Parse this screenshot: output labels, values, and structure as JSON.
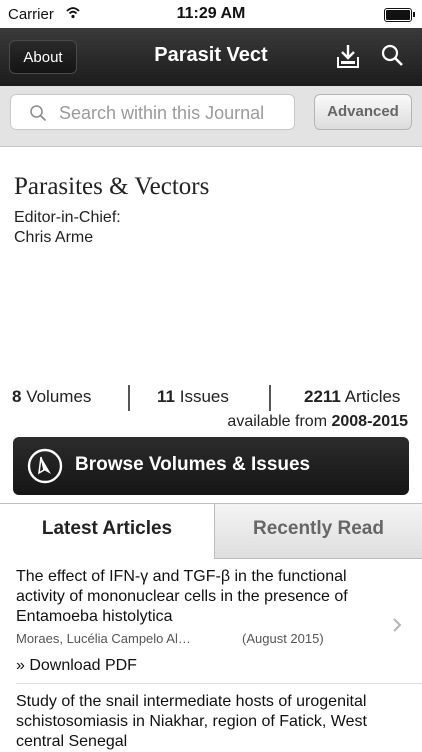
{
  "status_bar": {
    "carrier": "Carrier",
    "time": "11:29 AM"
  },
  "navbar": {
    "about_label": "About",
    "title": "Parasit Vect"
  },
  "search": {
    "placeholder": "Search within this Journal",
    "advanced_label": "Advanced"
  },
  "journal": {
    "title": "Parasites & Vectors",
    "editor_label": "Editor-in-Chief:",
    "editor_name": "Chris Arme"
  },
  "stats": {
    "volumes_count": "8",
    "volumes_label": "Volumes",
    "issues_count": "11",
    "issues_label": "Issues",
    "articles_count": "2211",
    "articles_label": "Articles",
    "available_label": "available from",
    "available_range": "2008-2015"
  },
  "browse_button": {
    "label": "Browse Volumes & Issues"
  },
  "tabs": [
    {
      "label": "Latest Articles",
      "active": true
    },
    {
      "label": "Recently Read",
      "active": false
    }
  ],
  "articles": [
    {
      "title": "The effect of IFN-γ and TGF-β in the functional activity of mononuclear cells in the presence of Entamoeba histolytica",
      "authors": "Moraes, Lucélia Campelo Al…",
      "date": "(August 2015)",
      "download_label": "» Download PDF"
    },
    {
      "title": "Study of the snail intermediate hosts of urogenital schistosomiasis in Niakhar, region of Fatick, West central Senegal"
    }
  ],
  "colors": {
    "navbar": "#1c1c1c",
    "searchbar": "#e3e3e3",
    "button_dark": "#151515"
  }
}
